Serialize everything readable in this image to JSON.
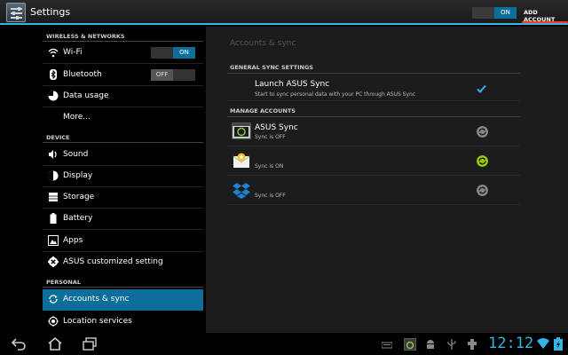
{
  "actionbar": {
    "title": "Settings",
    "toggle_label": "ON",
    "add_account_label": "ADD ACCOUNT"
  },
  "sidebar": {
    "sections": {
      "wireless": "WIRELESS & NETWORKS",
      "device": "DEVICE",
      "personal": "PERSONAL"
    },
    "items": [
      {
        "label": "Wi-Fi",
        "icon": "wifi-icon",
        "switch": "ON"
      },
      {
        "label": "Bluetooth",
        "icon": "bluetooth-icon",
        "switch": "OFF"
      },
      {
        "label": "Data usage",
        "icon": "data-usage-icon"
      },
      {
        "label": "More...",
        "icon": ""
      },
      {
        "label": "Sound",
        "icon": "sound-icon"
      },
      {
        "label": "Display",
        "icon": "display-icon"
      },
      {
        "label": "Storage",
        "icon": "storage-icon"
      },
      {
        "label": "Battery",
        "icon": "battery-icon"
      },
      {
        "label": "Apps",
        "icon": "apps-icon"
      },
      {
        "label": "ASUS customized setting",
        "icon": "gear-icon"
      },
      {
        "label": "Accounts & sync",
        "icon": "sync-icon",
        "selected": true
      },
      {
        "label": "Location services",
        "icon": "location-icon"
      }
    ]
  },
  "main": {
    "title": "Accounts & sync",
    "general_header": "GENERAL SYNC SETTINGS",
    "launch": {
      "title": "Launch ASUS Sync",
      "subtitle": "Start to sync personal data with your PC through ASUS Sync",
      "checked": true
    },
    "manage_header": "MANAGE ACCOUNTS",
    "accounts": [
      {
        "name": "ASUS Sync",
        "status": "Sync is OFF",
        "icon": "asus-sync-app-icon",
        "sync_color": "#888888"
      },
      {
        "name": "",
        "status": "Sync is ON",
        "icon": "email-app-icon",
        "sync_color": "#99cc00"
      },
      {
        "name": "",
        "status": "Sync is OFF",
        "icon": "dropbox-app-icon",
        "sync_color": "#888888"
      }
    ]
  },
  "statusbar": {
    "time": "12:12"
  },
  "colors": {
    "accent": "#33b5e5",
    "selected": "#0e6e9a",
    "sync_on": "#99cc00"
  }
}
